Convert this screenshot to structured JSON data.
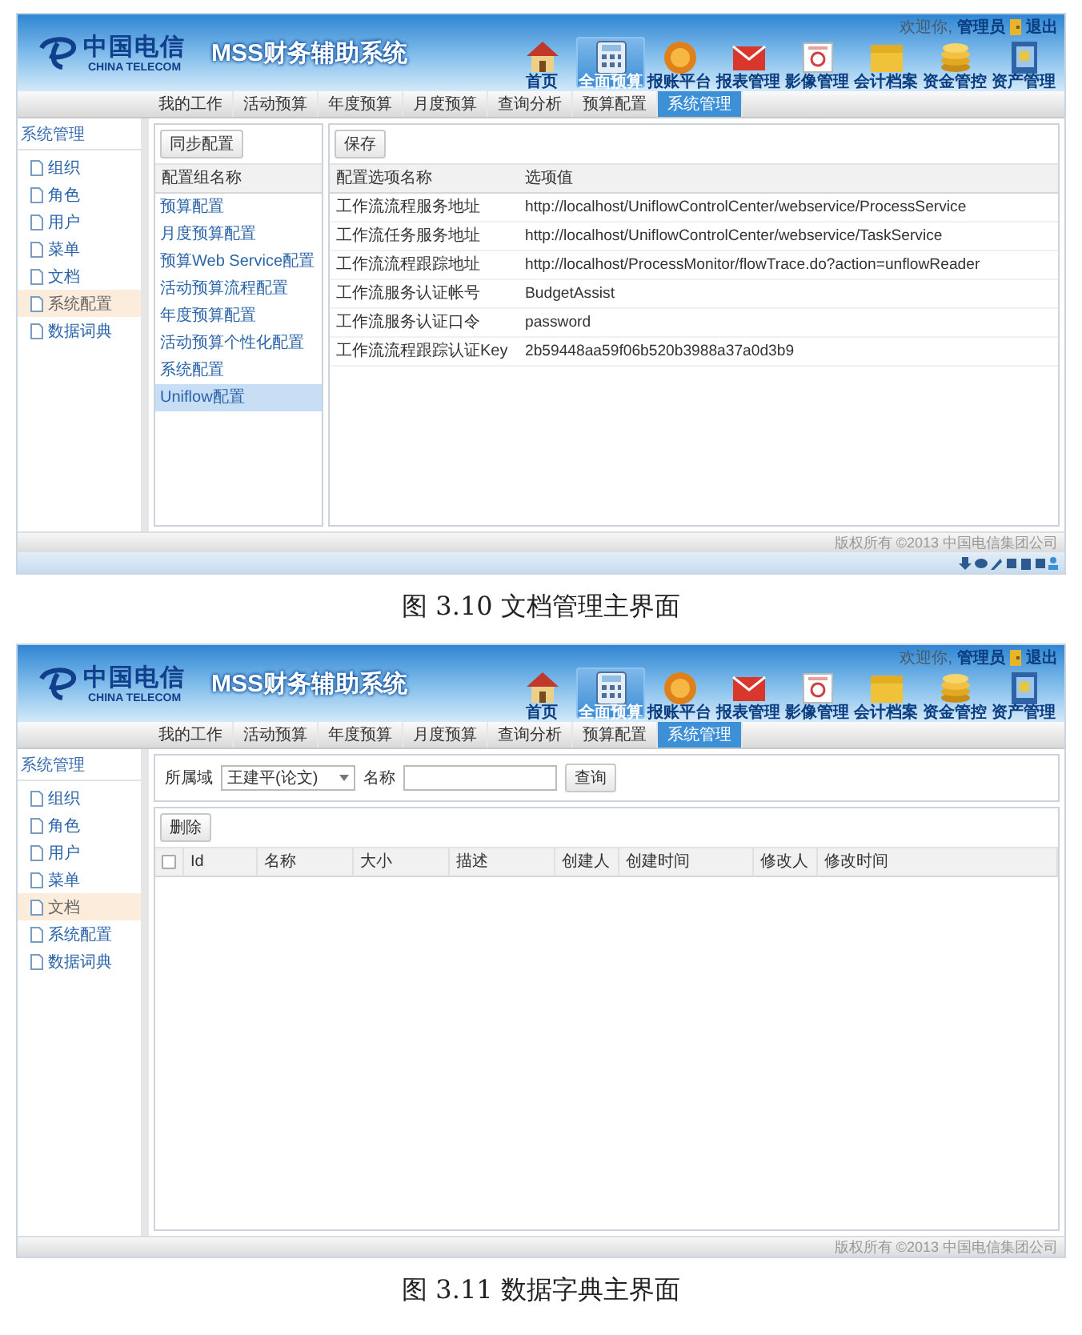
{
  "figures": [
    {
      "screen": {
        "header": {
          "logo_cn": "中国电信",
          "logo_en": "CHINA TELECOM",
          "title": "MSS财务辅助系统",
          "welcome": "欢迎你,",
          "user": "管理员",
          "logout": "退出",
          "nav": [
            {
              "label": "首页",
              "selected": false
            },
            {
              "label": "全面预算",
              "selected": true
            },
            {
              "label": "报账平台",
              "selected": false
            },
            {
              "label": "报表管理",
              "selected": false
            },
            {
              "label": "影像管理",
              "selected": false
            },
            {
              "label": "会计档案",
              "selected": false
            },
            {
              "label": "资金管控",
              "selected": false
            },
            {
              "label": "资产管理",
              "selected": false
            }
          ]
        },
        "tabs": [
          {
            "label": "我的工作",
            "selected": false
          },
          {
            "label": "活动预算",
            "selected": false
          },
          {
            "label": "年度预算",
            "selected": false
          },
          {
            "label": "月度预算",
            "selected": false
          },
          {
            "label": "查询分析",
            "selected": false
          },
          {
            "label": "预算配置",
            "selected": false
          },
          {
            "label": "系统管理",
            "selected": true
          }
        ],
        "sidebar": {
          "title": "系统管理",
          "items": [
            {
              "label": "组织",
              "selected": false
            },
            {
              "label": "角色",
              "selected": false
            },
            {
              "label": "用户",
              "selected": false
            },
            {
              "label": "菜单",
              "selected": false
            },
            {
              "label": "文档",
              "selected": false
            },
            {
              "label": "系统配置",
              "selected": true
            },
            {
              "label": "数据词典",
              "selected": false
            }
          ]
        },
        "content": {
          "kind": "config",
          "left": {
            "button": "同步配置",
            "column": "配置组名称",
            "items": [
              {
                "label": "预算配置",
                "selected": false
              },
              {
                "label": "月度预算配置",
                "selected": false
              },
              {
                "label": "预算Web Service配置",
                "selected": false
              },
              {
                "label": "活动预算流程配置",
                "selected": false
              },
              {
                "label": "年度预算配置",
                "selected": false
              },
              {
                "label": "活动预算个性化配置",
                "selected": false
              },
              {
                "label": "系统配置",
                "selected": false
              },
              {
                "label": "Uniflow配置",
                "selected": true
              }
            ]
          },
          "right": {
            "button": "保存",
            "columns": [
              "配置选项名称",
              "选项值"
            ],
            "rows": [
              [
                "工作流流程服务地址",
                "http://localhost/UniflowControlCenter/webservice/ProcessService"
              ],
              [
                "工作流任务服务地址",
                "http://localhost/UniflowControlCenter/webservice/TaskService"
              ],
              [
                "工作流流程跟踪地址",
                "http://localhost/ProcessMonitor/flowTrace.do?action=unflowReader"
              ],
              [
                "工作流服务认证帐号",
                "BudgetAssist"
              ],
              [
                "工作流服务认证口令",
                "password"
              ],
              [
                "工作流流程跟踪认证Key",
                "2b59448aa59f06b520b3988a37a0d3b9"
              ]
            ]
          }
        },
        "footer": {
          "copyright": "版权所有 ©2013 中国电信集团公司"
        },
        "has_status_bar": true
      },
      "caption": "图 3.10 文档管理主界面"
    },
    {
      "screen": {
        "header": {
          "logo_cn": "中国电信",
          "logo_en": "CHINA TELECOM",
          "title": "MSS财务辅助系统",
          "welcome": "欢迎你,",
          "user": "管理员",
          "logout": "退出",
          "nav": [
            {
              "label": "首页",
              "selected": false
            },
            {
              "label": "全面预算",
              "selected": true
            },
            {
              "label": "报账平台",
              "selected": false
            },
            {
              "label": "报表管理",
              "selected": false
            },
            {
              "label": "影像管理",
              "selected": false
            },
            {
              "label": "会计档案",
              "selected": false
            },
            {
              "label": "资金管控",
              "selected": false
            },
            {
              "label": "资产管理",
              "selected": false
            }
          ]
        },
        "tabs": [
          {
            "label": "我的工作",
            "selected": false
          },
          {
            "label": "活动预算",
            "selected": false
          },
          {
            "label": "年度预算",
            "selected": false
          },
          {
            "label": "月度预算",
            "selected": false
          },
          {
            "label": "查询分析",
            "selected": false
          },
          {
            "label": "预算配置",
            "selected": false
          },
          {
            "label": "系统管理",
            "selected": true
          }
        ],
        "sidebar": {
          "title": "系统管理",
          "items": [
            {
              "label": "组织",
              "selected": false
            },
            {
              "label": "角色",
              "selected": false
            },
            {
              "label": "用户",
              "selected": false
            },
            {
              "label": "菜单",
              "selected": false
            },
            {
              "label": "文档",
              "selected": true
            },
            {
              "label": "系统配置",
              "selected": false
            },
            {
              "label": "数据词典",
              "selected": false
            }
          ]
        },
        "content": {
          "kind": "list",
          "filter": {
            "domain_label": "所属域",
            "domain_value": "王建平(论文)",
            "name_label": "名称",
            "button": "查询"
          },
          "delete_button": "删除",
          "select_all": {
            "checked": false
          },
          "columns": [
            "Id",
            "名称",
            "大小",
            "描述",
            "创建人",
            "创建时间",
            "修改人",
            "修改时间"
          ]
        },
        "footer": {
          "copyright": "版权所有 ©2013 中国电信集团公司"
        },
        "has_status_bar": false
      },
      "caption": "图 3.11 数据字典主界面"
    }
  ]
}
